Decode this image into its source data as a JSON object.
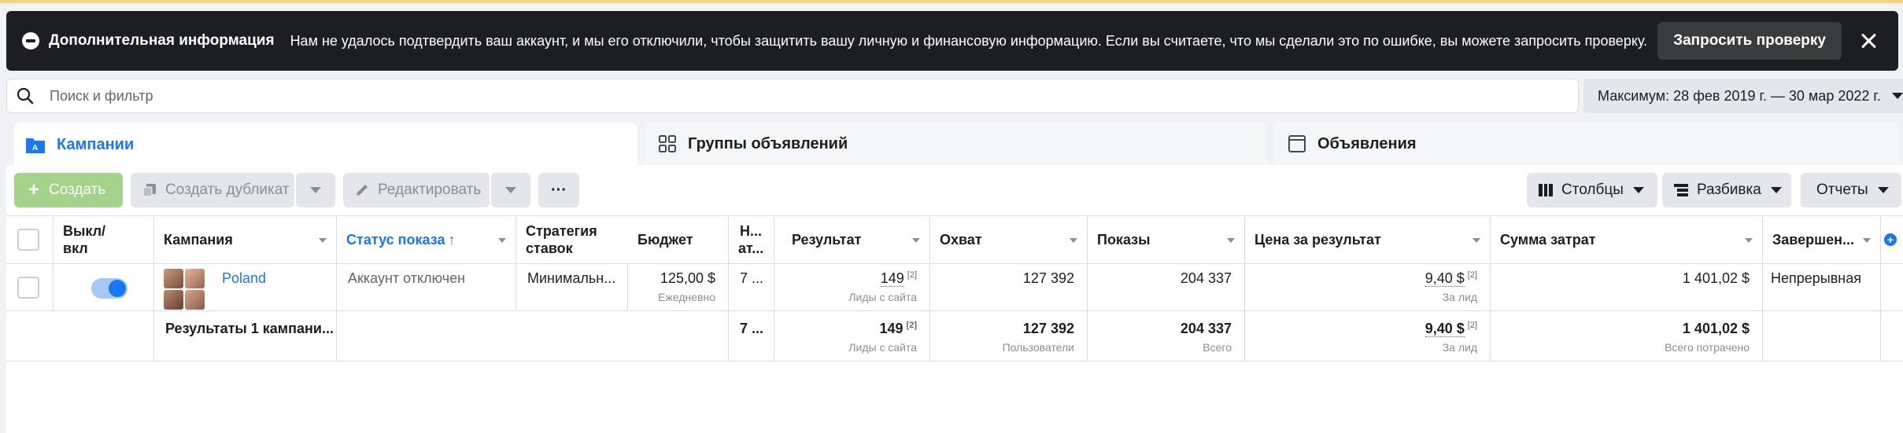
{
  "banner": {
    "title": "Дополнительная информация",
    "message": "Нам не удалось подтвердить ваш аккаунт, и мы его отключили, чтобы защитить вашу личную и финансовую информацию. Если вы считаете, что мы сделали это по ошибке, вы можете запросить проверку.",
    "button": "Запросить проверку",
    "icons": [
      "info-icon",
      "close-icon"
    ]
  },
  "search": {
    "placeholder": "Поиск и фильтр"
  },
  "date_range": "Максимум: 28 фев 2019 г. — 30 мар 2022 г.",
  "tabs": [
    {
      "label": "Кампании",
      "active": true,
      "icon": "campaign-icon"
    },
    {
      "label": "Группы объявлений",
      "active": false,
      "icon": "grid-icon"
    },
    {
      "label": "Объявления",
      "active": false,
      "icon": "ad-frame-icon"
    }
  ],
  "toolbar": {
    "create": "Создать",
    "duplicate": "Создать дубликат",
    "edit": "Редактировать",
    "more": "···",
    "columns": "Столбцы",
    "breakdown": "Разбивка",
    "reports": "Отчеты"
  },
  "table": {
    "headers": {
      "toggle": "Выкл/вкл",
      "campaign": "Кампания",
      "status": "Статус показа",
      "strategy": "Стратегия ставок",
      "budget": "Бюджет",
      "attribution": "Н... ат...",
      "result": "Результат",
      "reach": "Охват",
      "impressions": "Показы",
      "cost_per_result": "Цена за результат",
      "spent": "Сумма затрат",
      "ends": "Завершен..."
    },
    "status_sort_arrow": "↑",
    "rows": [
      {
        "campaign": "Poland",
        "status": "Аккаунт отключен",
        "strategy": "Минимальн...",
        "budget": "125,00 $",
        "budget_sub": "Ежедневно",
        "attribution": "7 ...",
        "result": "149",
        "result_sup": "[2]",
        "result_sub": "Лиды с сайта",
        "reach": "127 392",
        "impressions": "204 337",
        "cost": "9,40 $",
        "cost_sup": "[2]",
        "cost_sub": "За лид",
        "spent": "1 401,02 $",
        "ends": "Непрерывная"
      }
    ],
    "totals": {
      "label": "Результаты 1 кампани...",
      "attribution": "7 ...",
      "result": "149",
      "result_sup": "[2]",
      "result_sub": "Лиды с сайта",
      "reach": "127 392",
      "reach_sub": "Пользователи",
      "impressions": "204 337",
      "impressions_sub": "Всего",
      "cost": "9,40 $",
      "cost_sup": "[2]",
      "cost_sub": "За лид",
      "spent": "1 401,02 $",
      "spent_sub": "Всего потрачено"
    }
  },
  "colors": {
    "accent": "#1877f2",
    "banner": "#1c1e21",
    "create_button": "#a5d38c"
  }
}
